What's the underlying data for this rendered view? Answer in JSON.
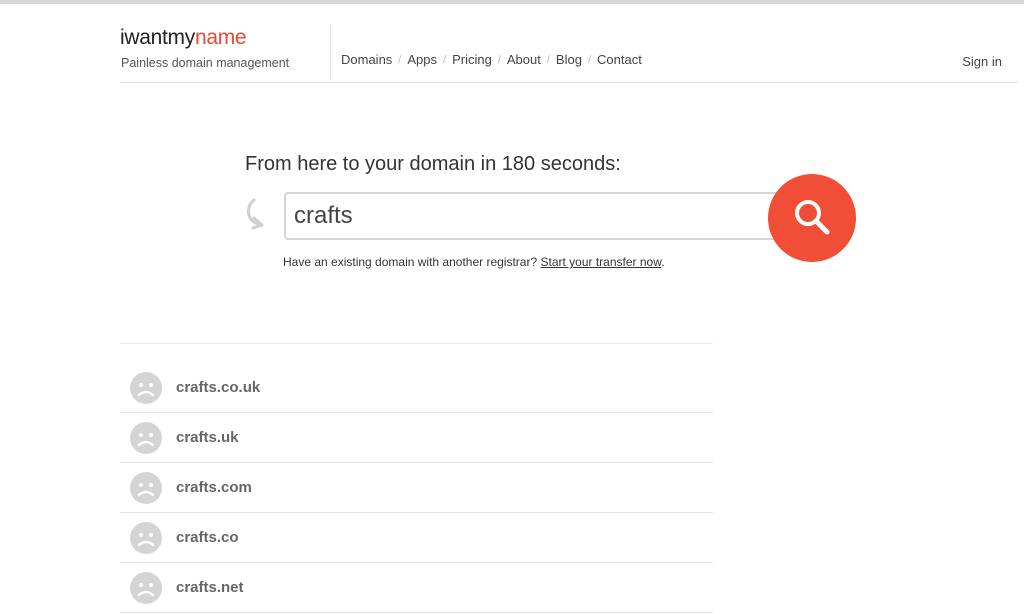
{
  "brand": {
    "logo_part1": "iwant",
    "logo_part2": "my",
    "logo_part3": "name",
    "tagline": "Painless domain management",
    "accent_color": "#ef4535"
  },
  "nav": {
    "items": [
      {
        "label": "Domains"
      },
      {
        "label": "Apps"
      },
      {
        "label": "Pricing"
      },
      {
        "label": "About"
      },
      {
        "label": "Blog"
      },
      {
        "label": "Contact"
      }
    ],
    "separator": "/",
    "signin_label": "Sign in"
  },
  "hero": {
    "headline": "From here to your domain in 180 seconds:"
  },
  "search": {
    "value": "crafts",
    "button_icon": "search-icon",
    "button_color": "#f04e37"
  },
  "transfer": {
    "text": "Have an existing domain with another registrar?",
    "link_label": "Start your transfer now",
    "suffix": "."
  },
  "results": [
    {
      "domain": "crafts.co.uk",
      "status_icon": "sad-face-icon"
    },
    {
      "domain": "crafts.uk",
      "status_icon": "sad-face-icon"
    },
    {
      "domain": "crafts.com",
      "status_icon": "sad-face-icon"
    },
    {
      "domain": "crafts.co",
      "status_icon": "sad-face-icon"
    },
    {
      "domain": "crafts.net",
      "status_icon": "sad-face-icon"
    }
  ]
}
